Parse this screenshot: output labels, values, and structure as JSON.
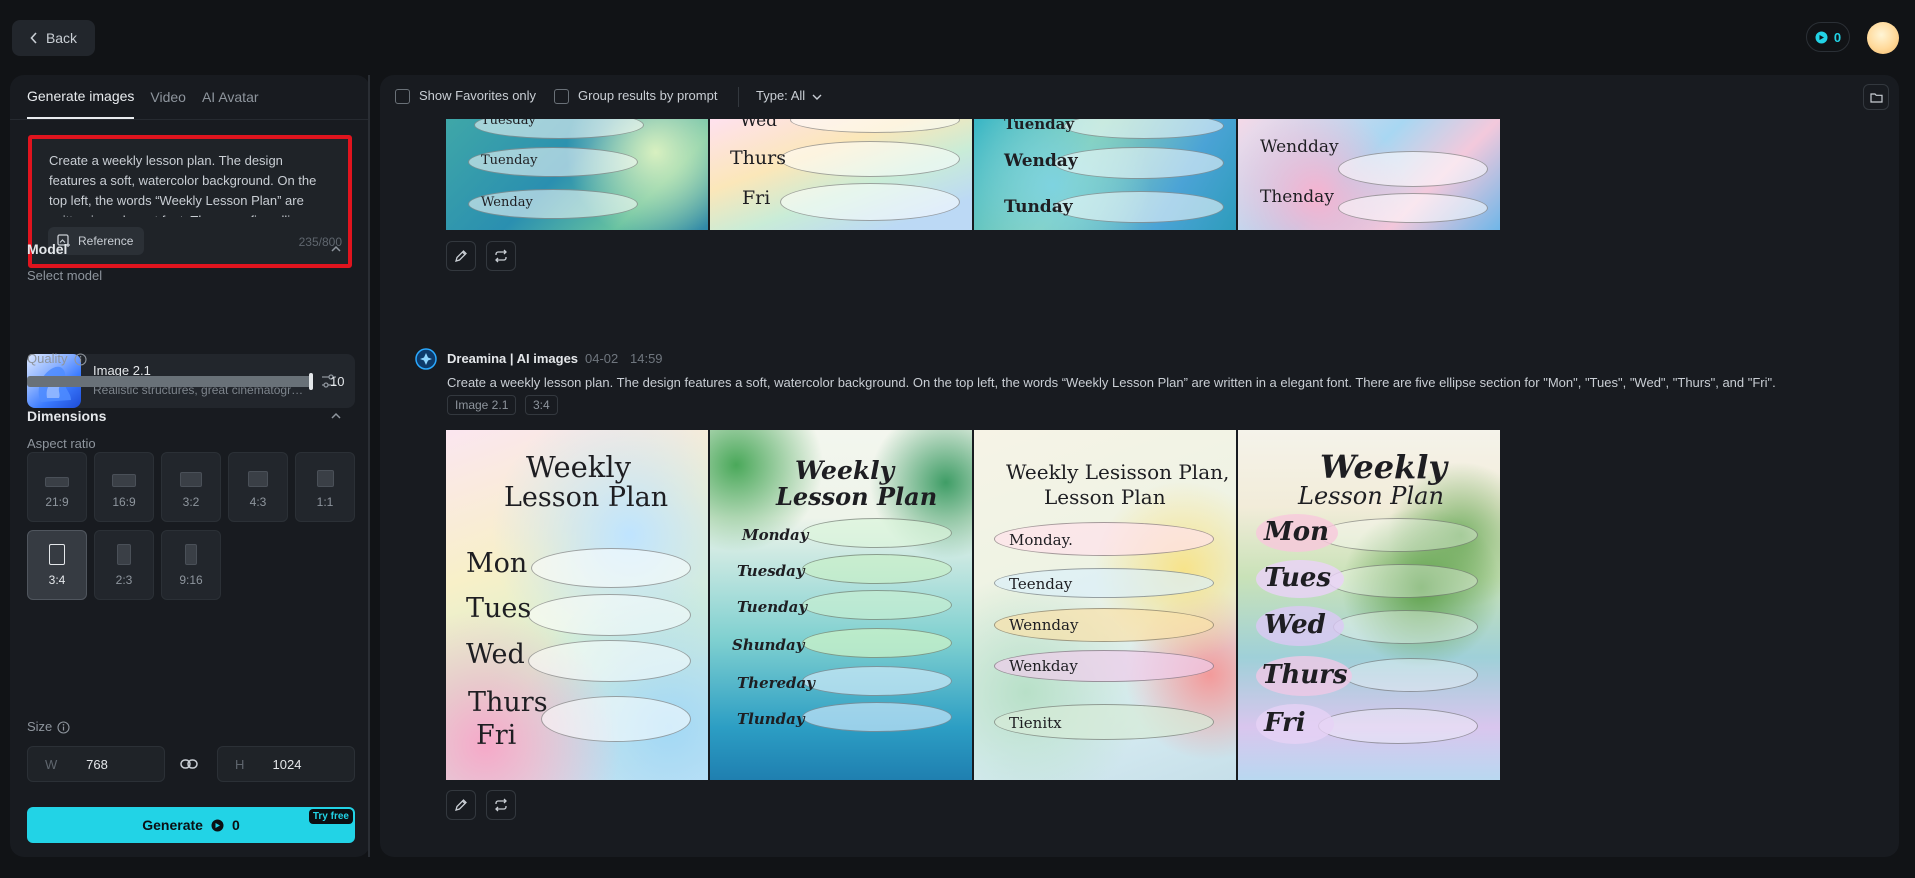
{
  "header": {
    "back_label": "Back",
    "credits": "0"
  },
  "left_panel": {
    "tabs": [
      {
        "label": "Generate images"
      },
      {
        "label": "Video"
      },
      {
        "label": "AI Avatar"
      }
    ],
    "prompt": {
      "text": "Create a weekly lesson plan. The design features a soft, watercolor background. On the top left, the words “Weekly Lesson Plan” are written in a elegant font. There are five ellipse section for \"Mon\", \"Tues\", \"Wed\", \"Thurs\", and \"Fri\".",
      "reference_label": "Reference",
      "counter": "235/800"
    },
    "model": {
      "section_title": "Model",
      "select_label": "Select model",
      "name": "Image 2.1",
      "description": "Realistic structures, great cinematography"
    },
    "quality": {
      "label": "Quality",
      "value": "10",
      "level": 1.0
    },
    "dimensions": {
      "section_title": "Dimensions",
      "aspect_label": "Aspect ratio",
      "ratios": [
        {
          "label": "21:9"
        },
        {
          "label": "16:9"
        },
        {
          "label": "3:2"
        },
        {
          "label": "4:3"
        },
        {
          "label": "1:1"
        },
        {
          "label": "3:4"
        },
        {
          "label": "2:3"
        },
        {
          "label": "9:16"
        }
      ],
      "selected": "3:4",
      "size_label": "Size",
      "width_key": "W",
      "width": "768",
      "height_key": "H",
      "height": "1024"
    },
    "generate": {
      "label": "Generate",
      "cost": "0",
      "badge": "Try free"
    }
  },
  "toolbar": {
    "favorites_label": "Show Favorites only",
    "group_label": "Group results by prompt",
    "type_label": "Type: All"
  },
  "result1": {
    "img1": {
      "lines": [
        "Tuesday",
        "Tuenday",
        "Wenday"
      ]
    },
    "img2": {
      "lines": [
        "Wed",
        "Thurs",
        "Fri"
      ]
    },
    "img3": {
      "lines": [
        "Tuenday",
        "Wenday",
        "Tunday"
      ]
    },
    "img4": {
      "lines": [
        "Wendday",
        "Thenday"
      ]
    }
  },
  "result2": {
    "title": "Dreamina | AI images",
    "date": "04-02",
    "time": "14:59",
    "prompt": "Create a weekly lesson plan. The design features a soft, watercolor background. On the top left, the words “Weekly Lesson Plan” are written in a elegant font. There are five ellipse section for \"Mon\", \"Tues\", \"Wed\", \"Thurs\", and \"Fri\".",
    "tags": [
      "Image 2.1",
      "3:4"
    ],
    "img1": {
      "title1": "Weekly",
      "title2": "Lesson Plan",
      "days": [
        "Mon",
        "Tues",
        "Wed",
        "Thurs",
        "Fri"
      ]
    },
    "img2": {
      "title1": "Weekly",
      "title2": "Lesson Plan",
      "days": [
        "Monday",
        "Tuesday",
        "Tuenday",
        "Shunday",
        "Thereday",
        "Tlunday"
      ]
    },
    "img3": {
      "title1": "Weekly Lesisson Plan,",
      "title2": "Lesson Plan",
      "days": [
        "Monday.",
        "Teenday",
        "Wennday",
        "Wenkday",
        "Tienitx"
      ]
    },
    "img4": {
      "title1": "Weekly",
      "title2": "Lesson Plan",
      "days": [
        "Mon",
        "Tues",
        "Wed",
        "Thurs",
        "Fri"
      ]
    }
  },
  "colors": {
    "accent": "#22d3e6",
    "highlight_border": "#e0141e",
    "background": "#111316",
    "panel": "#181b20"
  }
}
